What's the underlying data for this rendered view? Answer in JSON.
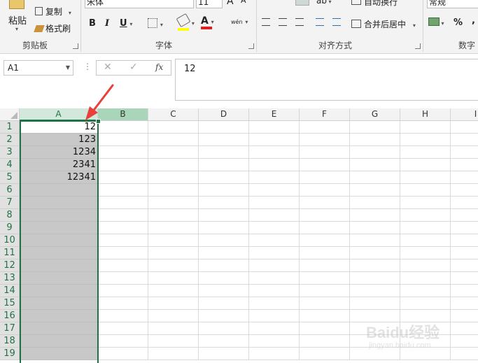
{
  "ribbon": {
    "clipboard": {
      "paste_label": "粘贴",
      "copy_label": "复制",
      "format_painter_label": "格式刷",
      "group_label": "剪贴板"
    },
    "font": {
      "font_name": "宋体",
      "font_size": "11",
      "group_label": "字体",
      "bold": "B",
      "italic": "I",
      "underline": "U",
      "phonetic": "wén"
    },
    "alignment": {
      "wrap_text_label": "自动换行",
      "merge_center_label": "合并后居中",
      "group_label": "对齐方式"
    },
    "number": {
      "format": "常规",
      "group_label": "数字",
      "percent": "%",
      "comma": ","
    }
  },
  "formula_bar": {
    "name_box": "A1",
    "fx": "fx",
    "formula": "12"
  },
  "columns": [
    "A",
    "B",
    "C",
    "D",
    "E",
    "F",
    "G",
    "H",
    "I"
  ],
  "selected_column": "A",
  "rows": [
    "1",
    "2",
    "3",
    "4",
    "5",
    "6",
    "7",
    "8",
    "9",
    "10",
    "11",
    "12",
    "13",
    "14",
    "15",
    "16",
    "17",
    "18",
    "19"
  ],
  "column_a_values": [
    "12",
    "123",
    "1234",
    "2341",
    "12341"
  ],
  "watermark": {
    "brand": "Baidu经验",
    "url": "jingyan.baidu.com"
  },
  "colors": {
    "accent": "#217346",
    "annotation_arrow": "#e8403a"
  }
}
